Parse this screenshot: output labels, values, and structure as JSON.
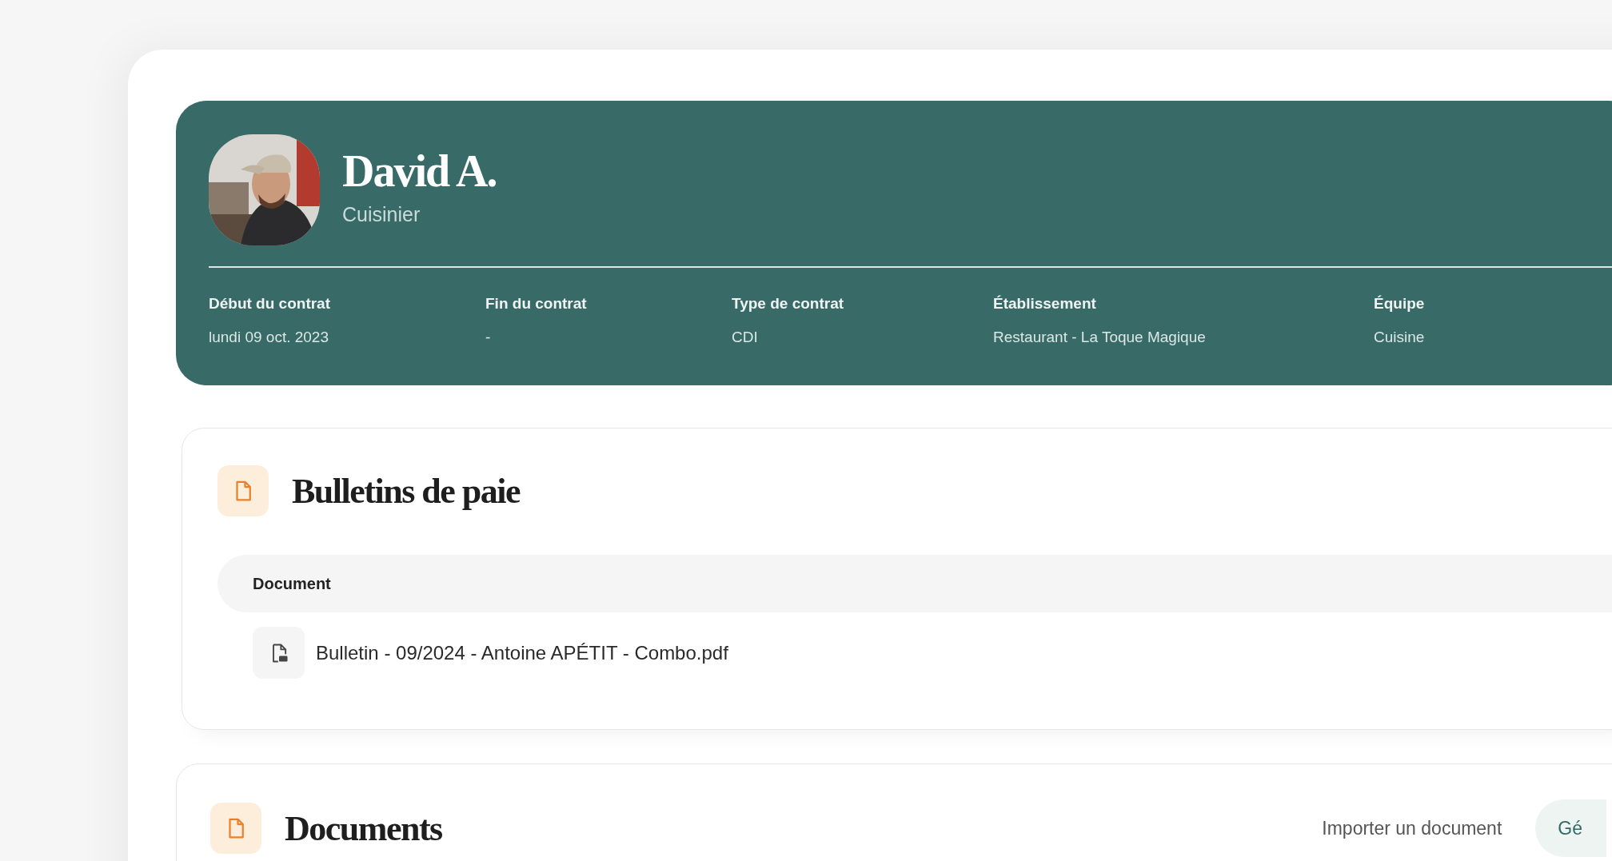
{
  "profile": {
    "name": "David A.",
    "role": "Cuisinier"
  },
  "contract_fields": [
    {
      "label": "Début du contrat",
      "value": "lundi 09 oct. 2023"
    },
    {
      "label": "Fin du contrat",
      "value": "-"
    },
    {
      "label": "Type de contrat",
      "value": "CDI"
    },
    {
      "label": "Établissement",
      "value": "Restaurant - La Toque Magique"
    },
    {
      "label": "Équipe",
      "value": "Cuisine"
    }
  ],
  "payslips": {
    "title": "Bulletins de paie",
    "columns": [
      "Document"
    ],
    "rows": [
      {
        "document": "Bulletin - 09/2024 - Antoine APÉTIT - Combo.pdf"
      }
    ]
  },
  "documents": {
    "title": "Documents",
    "import_link": "Importer un document",
    "generate_button": "Gé"
  }
}
